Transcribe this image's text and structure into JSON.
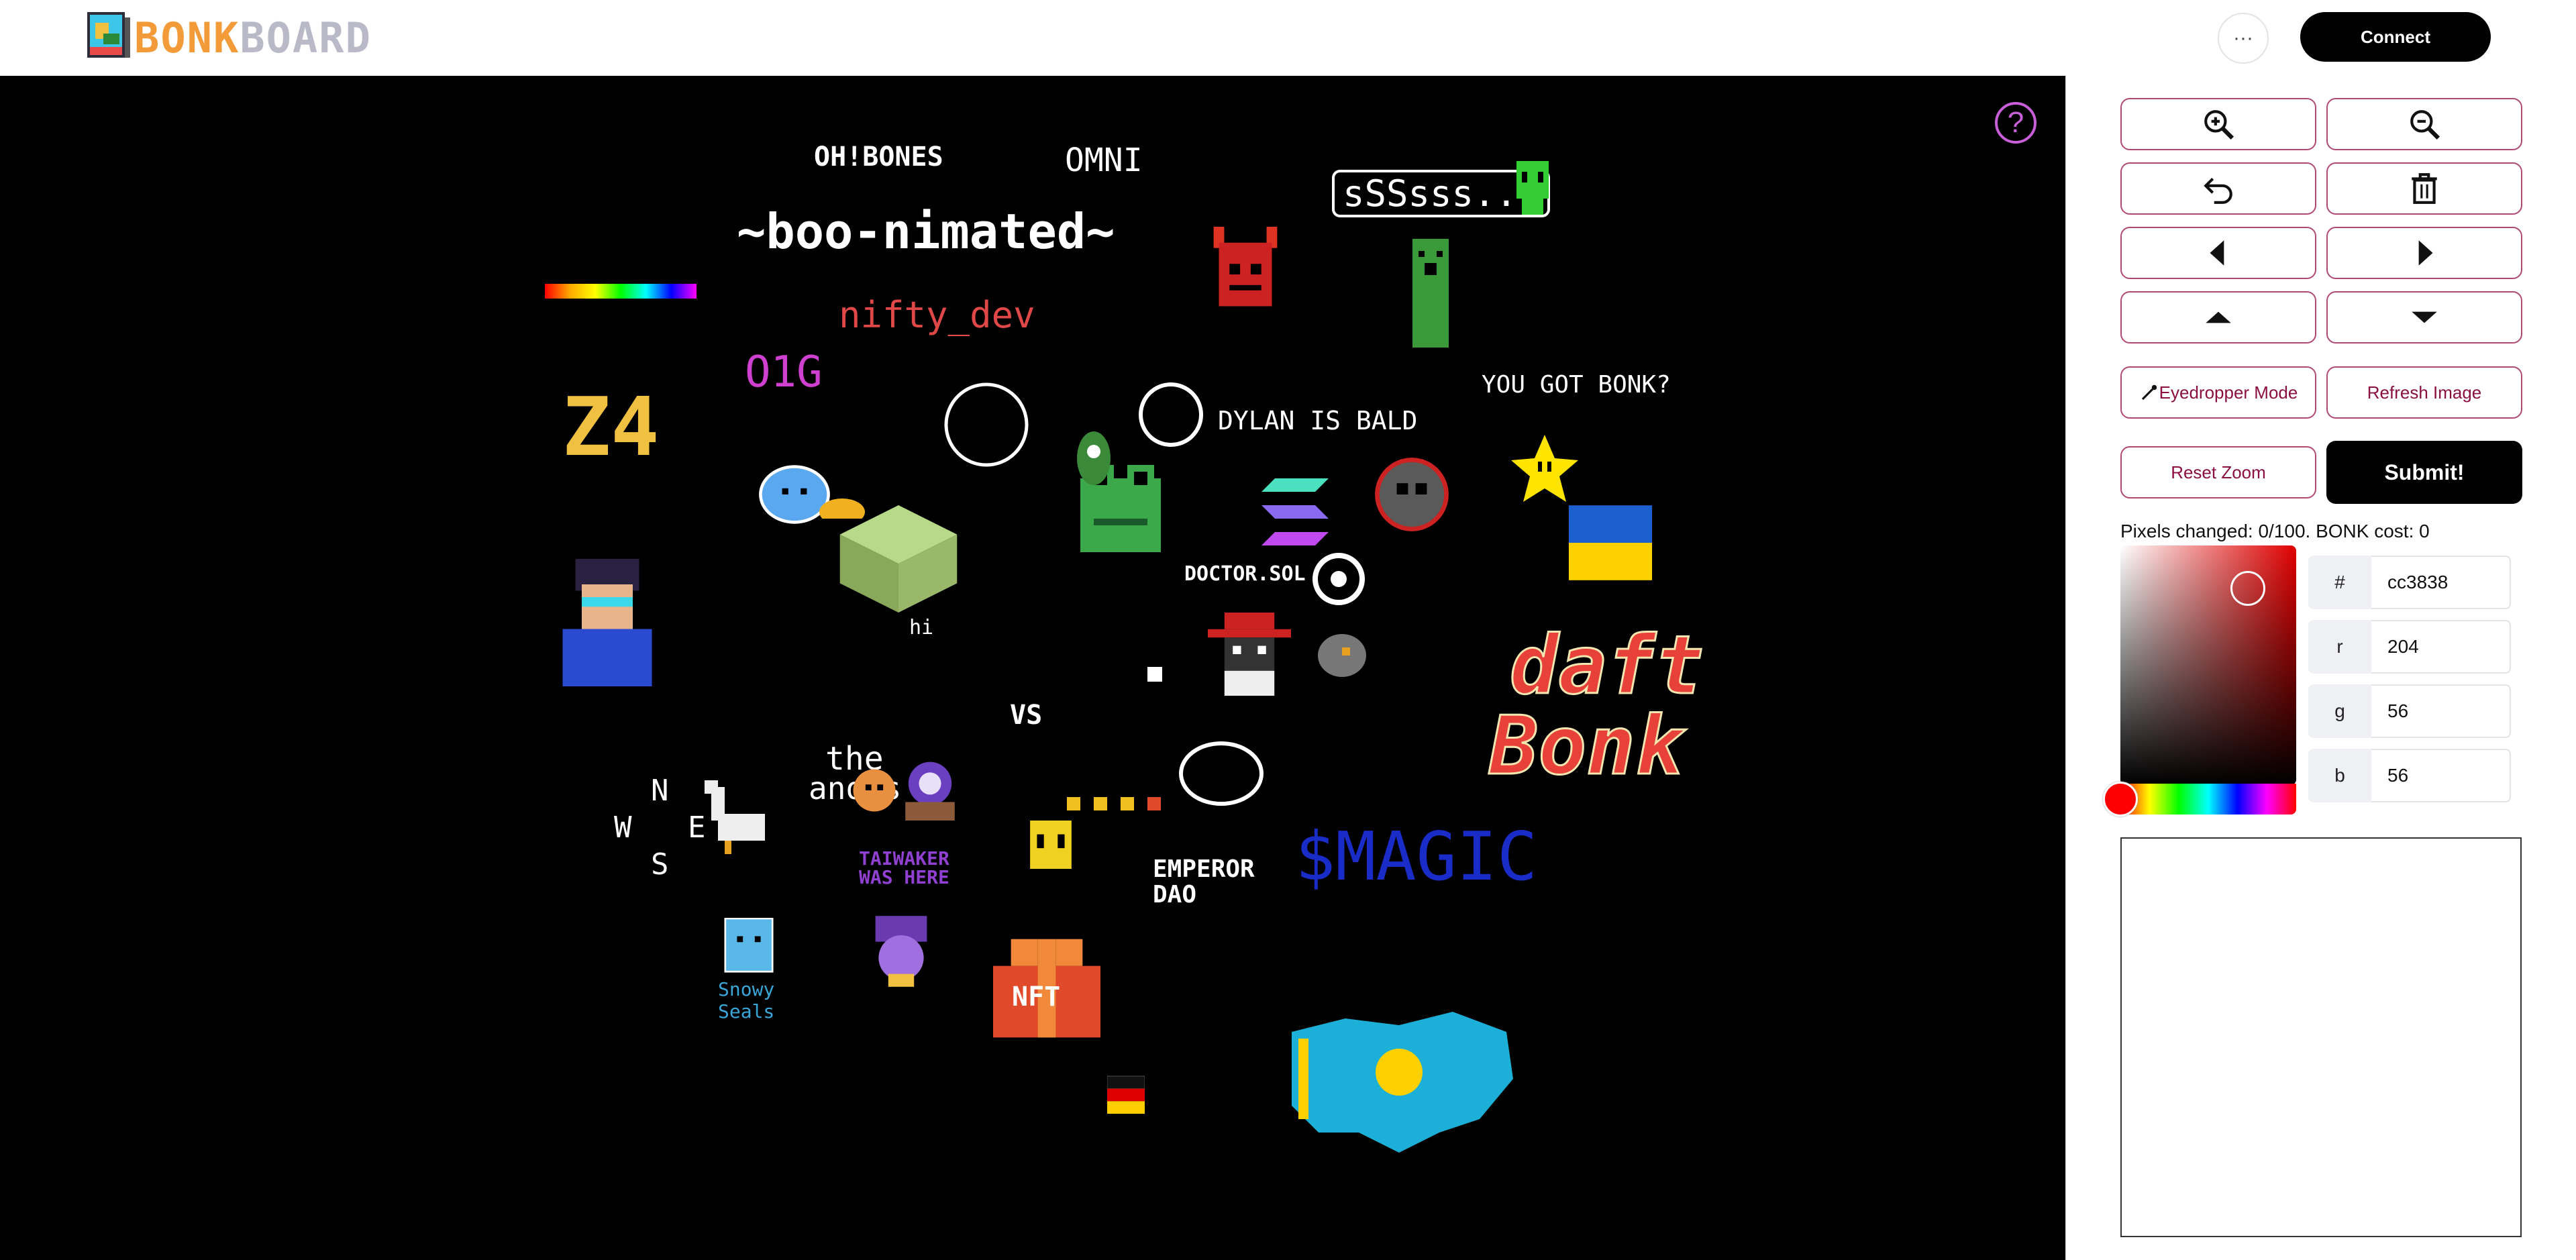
{
  "header": {
    "logo_bonk": "BONK",
    "logo_board": "BOARD",
    "more_label": "···",
    "connect_label": "Connect"
  },
  "canvas": {
    "help_label": "?",
    "art_labels": {
      "ohbones": "OH!BONES",
      "omni": "OMNI",
      "boonimated": "~boo-nimated~",
      "sssss": "sSSsss...",
      "nifty": "nifty_dev",
      "o1g": "O1G",
      "z4": "Z4",
      "dylan": "DYLAN IS BALD",
      "yougotbonk": "YOU GOT BONK?",
      "doctor": "DOCTOR.SOL",
      "hi": "hi",
      "vs": "VS",
      "the": "the",
      "anons": "anons",
      "compass_n": "N",
      "compass_w": "W",
      "compass_e": "E",
      "compass_s": "S",
      "taiwaker": "TAIWAKER",
      "washere": "WAS HERE",
      "emperor": "EMPEROR",
      "dao": "DAO",
      "magic": "$MAGIC",
      "daft": "daft",
      "bonk": "Bonk",
      "snowy": "Snowy",
      "seals": "Seals",
      "nft": "NFT"
    }
  },
  "toolbar": {
    "zoom_in_icon": "zoom-in-icon",
    "zoom_out_icon": "zoom-out-icon",
    "undo_icon": "undo-icon",
    "trash_icon": "trash-icon",
    "left_icon": "arrow-left-icon",
    "right_icon": "arrow-right-icon",
    "up_icon": "arrow-up-icon",
    "down_icon": "arrow-down-icon",
    "eyedropper_label": "Eyedropper Mode",
    "refresh_label": "Refresh Image",
    "reset_zoom_label": "Reset Zoom",
    "submit_label": "Submit!",
    "accent_color": "#b14a73"
  },
  "status": {
    "text": "Pixels changed: 0/100. BONK cost: 0"
  },
  "color": {
    "hex_label": "#",
    "hex_value": "cc3838",
    "r_label": "r",
    "r_value": "204",
    "g_label": "g",
    "g_value": "56",
    "b_label": "b",
    "b_value": "56"
  }
}
